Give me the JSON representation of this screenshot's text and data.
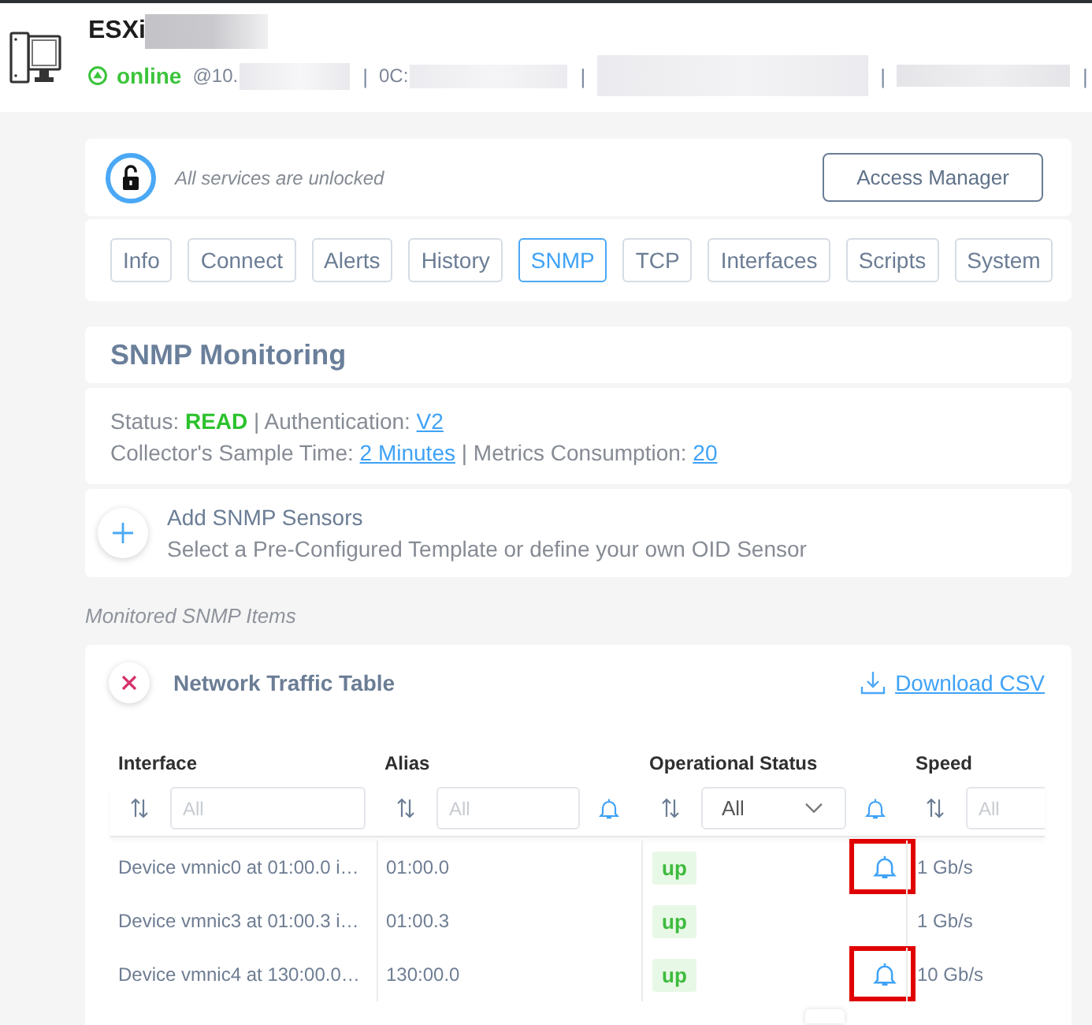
{
  "header": {
    "title": "ESXi",
    "title_redacted": true,
    "status_line": [
      {
        "kind": "status",
        "text": "online"
      },
      {
        "kind": "text",
        "text": "@10."
      },
      {
        "kind": "redacted"
      },
      {
        "kind": "separator",
        "text": "|"
      },
      {
        "kind": "text",
        "text": "0C:"
      },
      {
        "kind": "redacted"
      },
      {
        "kind": "separator",
        "text": "|"
      },
      {
        "kind": "redacted"
      },
      {
        "kind": "separator",
        "text": "|"
      },
      {
        "kind": "redacted"
      },
      {
        "kind": "separator",
        "text": "|"
      }
    ]
  },
  "access": {
    "locked": false,
    "message": "All services are unlocked",
    "button": "Access Manager"
  },
  "tabs": [
    {
      "label": "Info",
      "selected": false
    },
    {
      "label": "Connect",
      "selected": false
    },
    {
      "label": "Alerts",
      "selected": false
    },
    {
      "label": "History",
      "selected": false
    },
    {
      "label": "SNMP",
      "selected": true
    },
    {
      "label": "TCP",
      "selected": false
    },
    {
      "label": "Interfaces",
      "selected": false
    },
    {
      "label": "Scripts",
      "selected": false
    },
    {
      "label": "System",
      "selected": false
    }
  ],
  "section_title": "SNMP Monitoring",
  "summary": [
    {
      "parts": [
        {
          "kind": "text",
          "text": "Status: "
        },
        {
          "kind": "status",
          "text": "READ"
        },
        {
          "kind": "text",
          "text": " | Authentication: "
        },
        {
          "kind": "link",
          "text": "V2"
        }
      ]
    },
    {
      "parts": [
        {
          "kind": "text",
          "text": "Collector's Sample Time: "
        },
        {
          "kind": "link",
          "text": "2 Minutes"
        },
        {
          "kind": "text",
          "text": " | Metrics Consumption: "
        },
        {
          "kind": "link",
          "text": "20"
        }
      ]
    }
  ],
  "add_sensors": {
    "title": "Add SNMP Sensors",
    "description": "Select a Pre-Configured Template or define your own OID Sensor"
  },
  "items_label": "Monitored SNMP Items",
  "table_card": {
    "title": "Network Traffic Table",
    "download": "Download CSV",
    "columns": [
      {
        "label": "Interface",
        "filter": {
          "kind": "input",
          "placeholder": "All"
        },
        "alert": false
      },
      {
        "label": "Alias",
        "filter": {
          "kind": "input",
          "placeholder": "All"
        },
        "alert": true
      },
      {
        "label": "Operational Status",
        "filter": {
          "kind": "select",
          "value": "All"
        },
        "alert": true
      },
      {
        "label": "Speed",
        "filter": {
          "kind": "input",
          "placeholder": "All"
        },
        "alert": false
      }
    ],
    "rows": [
      {
        "interface": "Device vmnic0 at 01:00.0 i…",
        "alias": "01:00.0",
        "status": "up",
        "alert": true,
        "highlighted": true,
        "speed": "1 Gb/s"
      },
      {
        "interface": "Device vmnic3 at 01:00.3 i…",
        "alias": "01:00.3",
        "status": "up",
        "alert": false,
        "highlighted": false,
        "speed": "1 Gb/s"
      },
      {
        "interface": "Device vmnic4 at 130:00.0…",
        "alias": "130:00.0",
        "status": "up",
        "alert": true,
        "highlighted": true,
        "speed": "10 Gb/s"
      }
    ]
  }
}
